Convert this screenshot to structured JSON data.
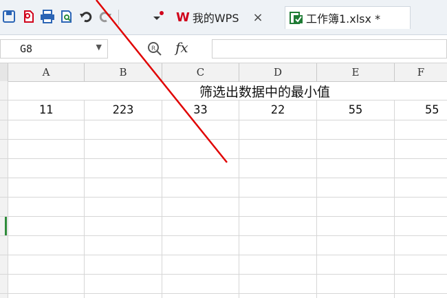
{
  "toolbar": {
    "icons": [
      "save-icon",
      "new-doc-icon",
      "print-icon",
      "print-preview-icon",
      "undo-icon",
      "redo-icon",
      "customize-dropdown-icon"
    ],
    "tabs": [
      {
        "label": "我的WPS",
        "close": "×",
        "logo": "W"
      },
      {
        "label": "工作簿1.xlsx *",
        "active": true
      }
    ]
  },
  "formula_bar": {
    "cell_ref": "G8",
    "fx": "fx",
    "formula": ""
  },
  "columns": [
    "A",
    "B",
    "C",
    "D",
    "E",
    "F"
  ],
  "sheet": {
    "title": "筛选出数据中的最小值",
    "values": [
      "11",
      "223",
      "33",
      "22",
      "55",
      "55"
    ]
  },
  "annotation": {
    "color": "#e00000"
  },
  "colors": {
    "wps_red": "#d0021b",
    "excel_green": "#1e7b34",
    "selected_row": "#2e8b3a"
  }
}
